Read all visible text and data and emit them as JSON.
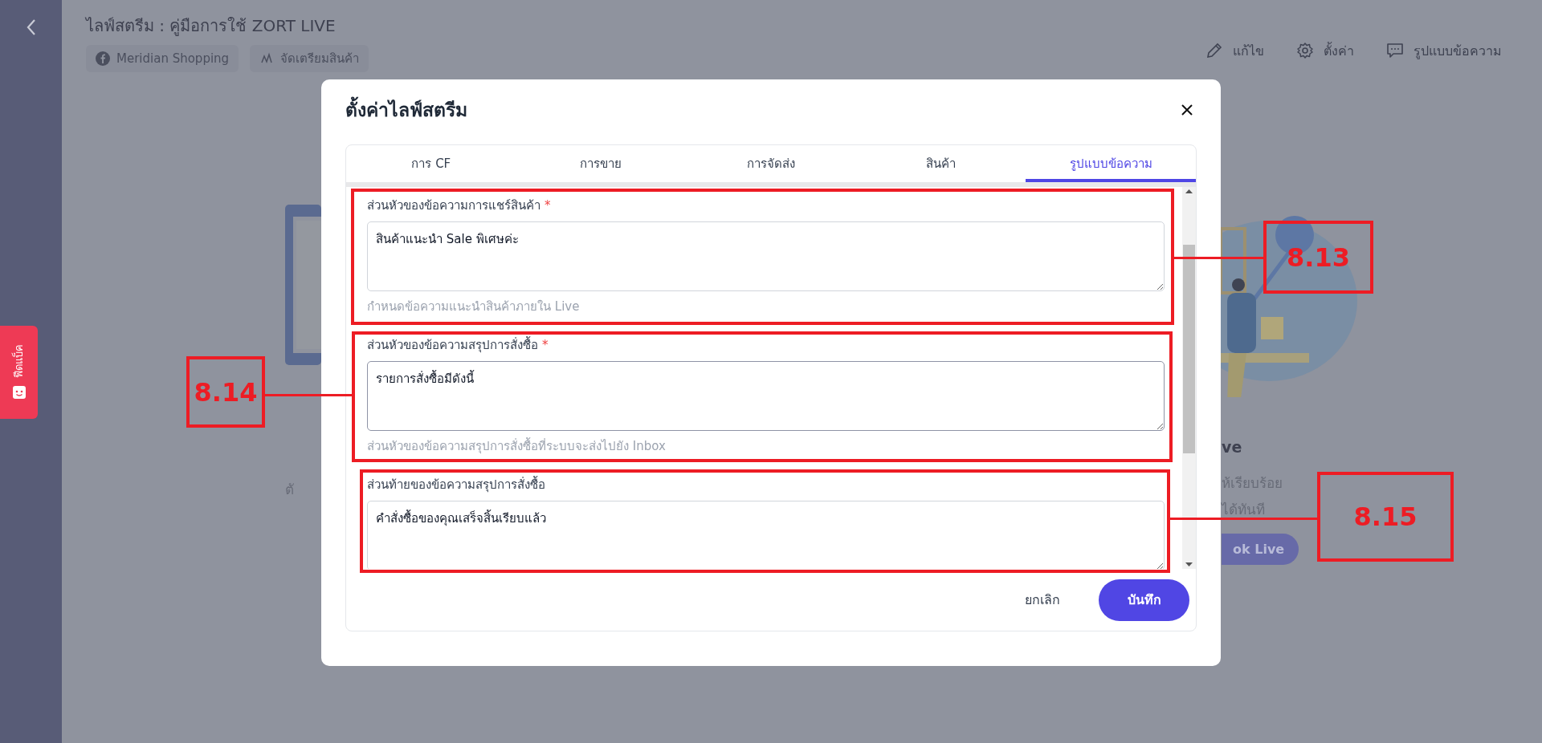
{
  "sidebar": {
    "feedback_tab": "ฟีดแบ็ค"
  },
  "header": {
    "title": "ไลฟ์สตรีม : คู่มือการใช้ ZORT LIVE",
    "chips": [
      {
        "kind": "facebook",
        "label": "Meridian Shopping"
      },
      {
        "kind": "prepare",
        "label": "จัดเตรียมสินค้า"
      }
    ],
    "actions": [
      {
        "kind": "edit",
        "label": "แก้ไข"
      },
      {
        "kind": "settings",
        "label": "ตั้งค่า"
      },
      {
        "kind": "message",
        "label": "รูปแบบข้อความ"
      }
    ]
  },
  "background": {
    "left_text": "ตั",
    "right_heading": "ve",
    "right_lines": [
      "ห้เรียบร้อย",
      "ได้ทันที"
    ],
    "right_button": "ok Live"
  },
  "dialog": {
    "title": "ตั้งค่าไลฟ์สตรีม",
    "tabs": [
      {
        "label": "การ CF",
        "selected": false
      },
      {
        "label": "การขาย",
        "selected": false
      },
      {
        "label": "การจัดส่ง",
        "selected": false
      },
      {
        "label": "สินค้า",
        "selected": false
      },
      {
        "label": "รูปแบบข้อความ",
        "selected": true
      }
    ],
    "fields": [
      {
        "label": "ส่วนหัวของข้อความการแชร์สินค้า",
        "required": true,
        "value": "สินค้าแนะนำ Sale พิเศษค่ะ",
        "help": "กำหนดข้อความแนะนำสินค้าภายใน Live",
        "focused": false
      },
      {
        "label": "ส่วนหัวของข้อความสรุปการสั่งซื้อ",
        "required": true,
        "value": "รายการสั่งซื้อมีดังนี้",
        "help": "ส่วนหัวของข้อความสรุปการสั่งซื้อที่ระบบจะส่งไปยัง Inbox",
        "focused": true
      },
      {
        "label": "ส่วนท้ายของข้อความสรุปการสั่งซื้อ",
        "required": false,
        "value": "คำสั่งซื้อของคุณเสร็จสิ้นเรียบแล้ว",
        "focused": false
      }
    ],
    "required_mark": "*",
    "cancel": "ยกเลิก",
    "save": "บันทึก"
  },
  "annotations": [
    {
      "label": "8.13"
    },
    {
      "label": "8.14"
    },
    {
      "label": "8.15"
    }
  ]
}
